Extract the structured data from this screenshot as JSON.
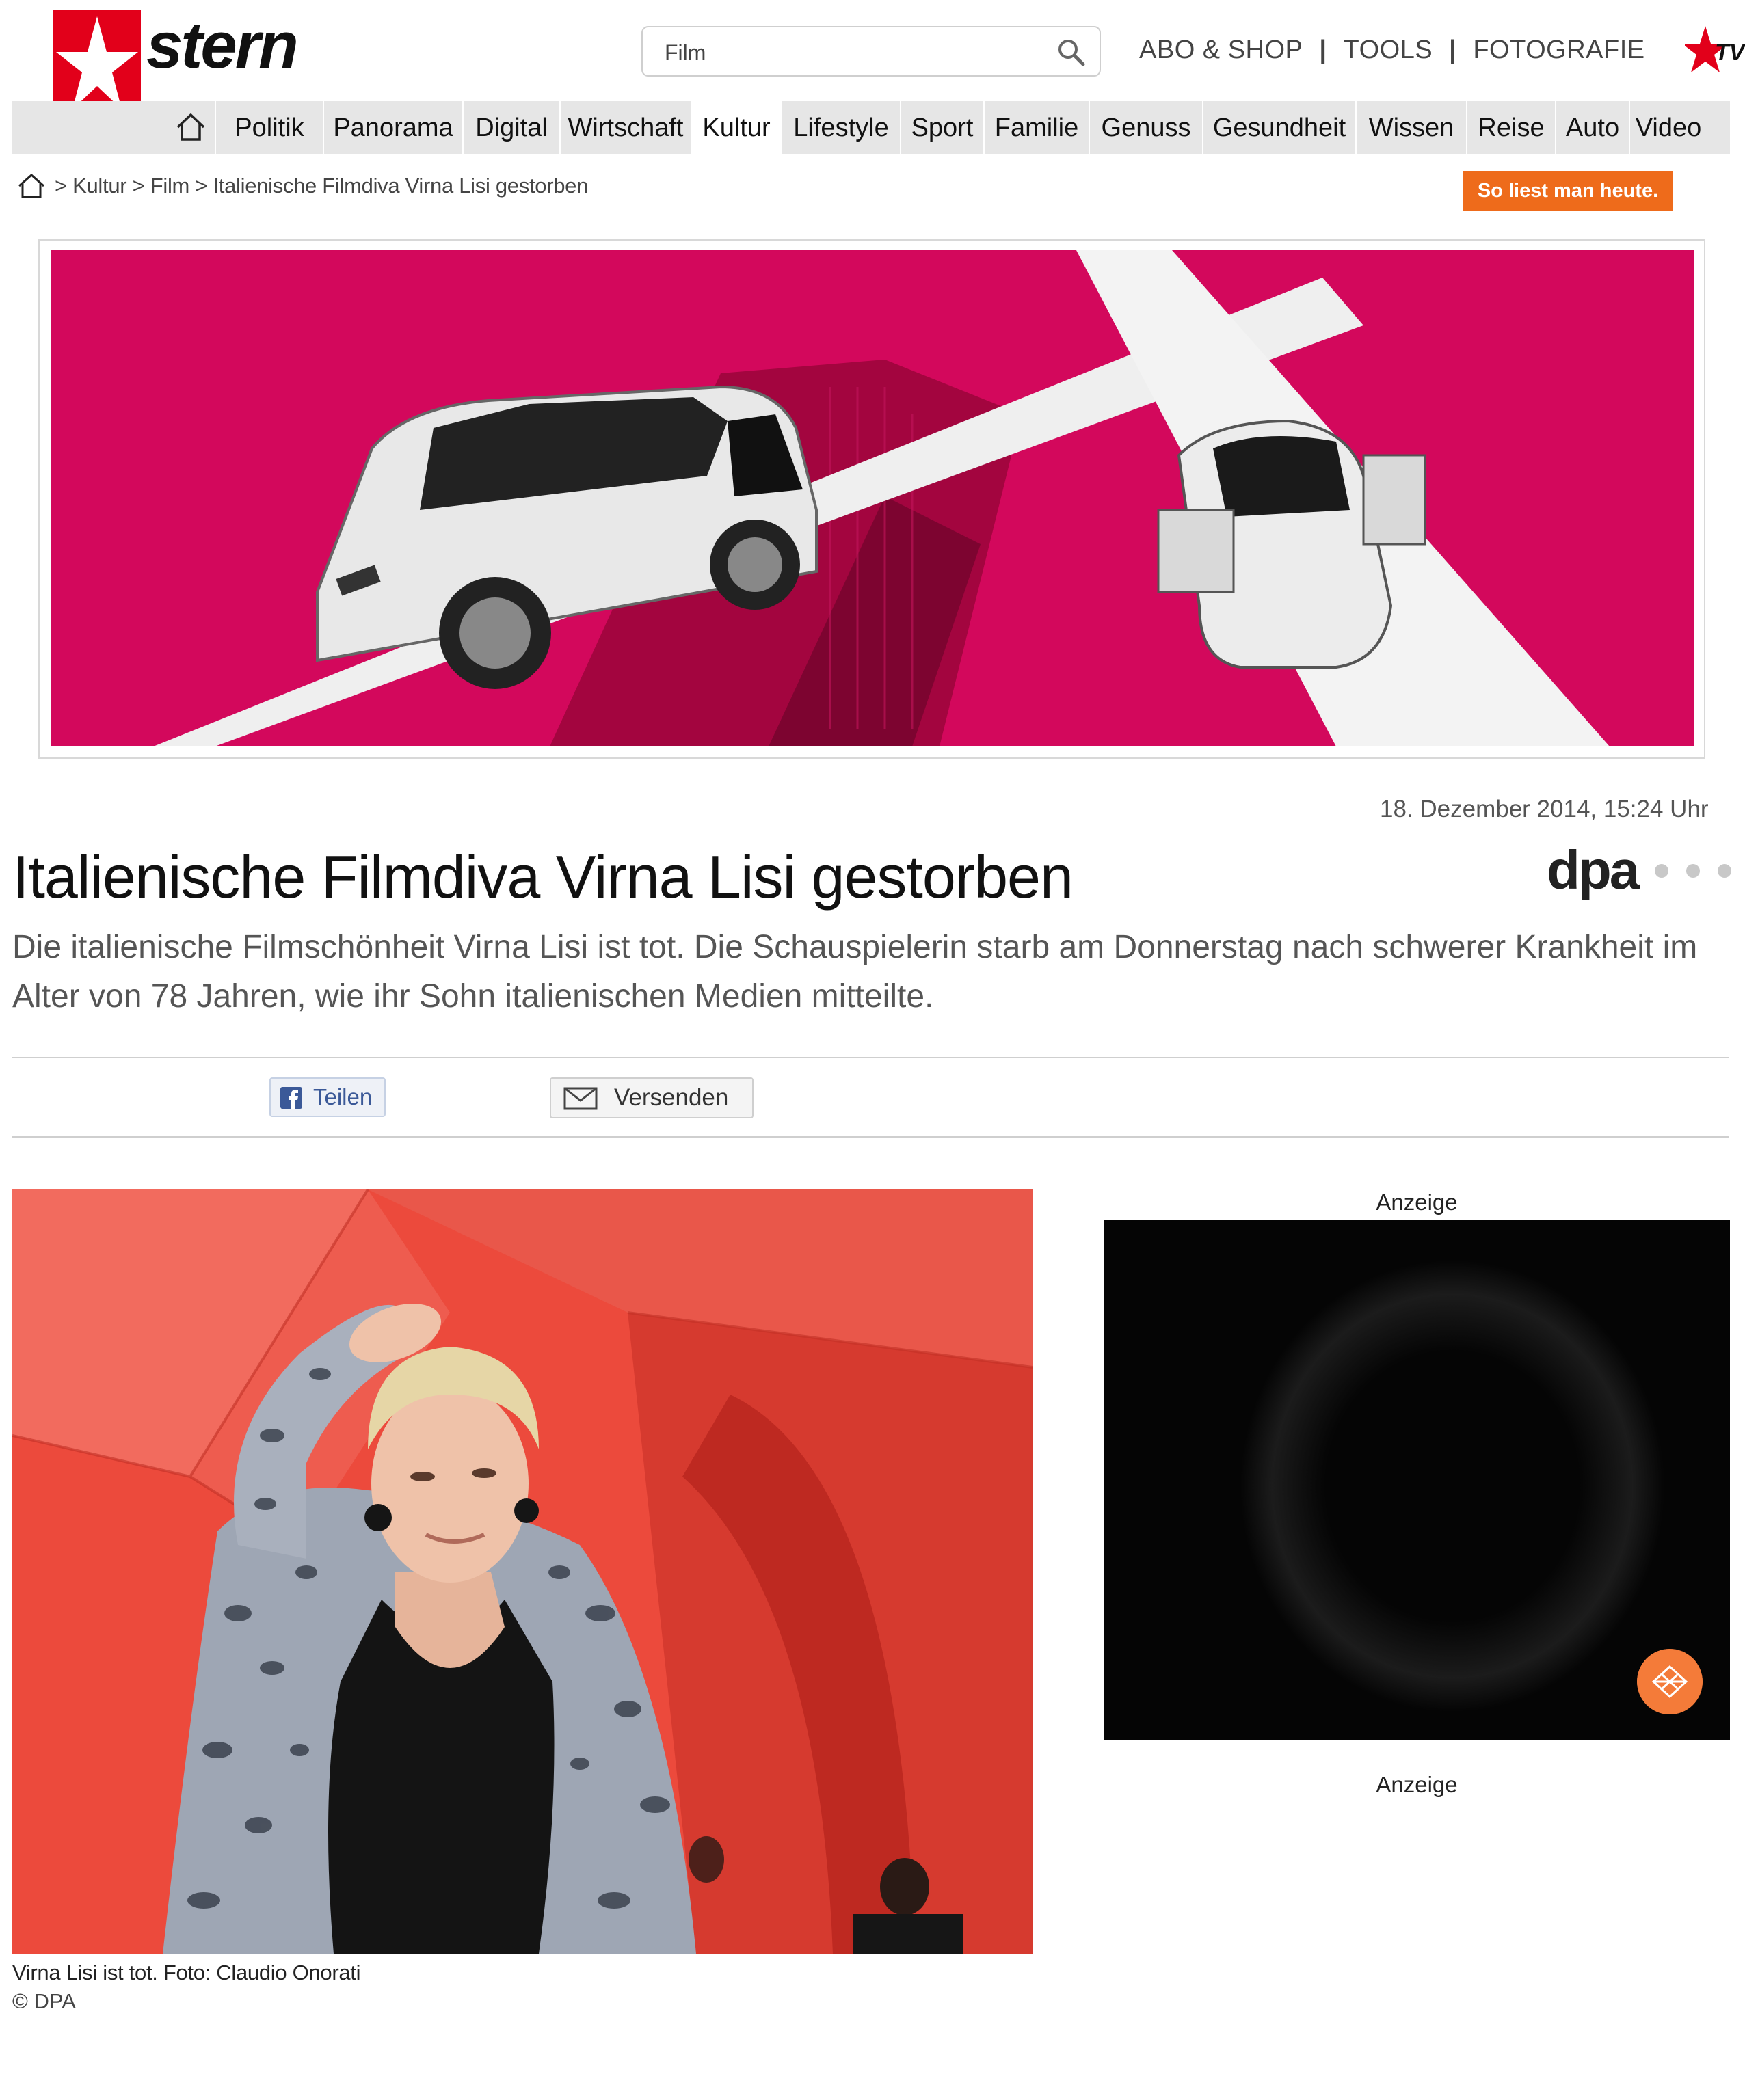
{
  "header": {
    "logo_text": "stern",
    "search": {
      "value": "Film",
      "placeholder": "Film"
    },
    "top_links": [
      "ABO & SHOP",
      "TOOLS",
      "FOTOGRAFIE"
    ],
    "separator": "|",
    "tv_logo_text": "stern TV"
  },
  "nav": {
    "items": [
      "Politik",
      "Panorama",
      "Digital",
      "Wirtschaft",
      "Kultur",
      "Lifestyle",
      "Sport",
      "Familie",
      "Genuss",
      "Gesundheit",
      "Wissen",
      "Reise",
      "Auto",
      "Video"
    ],
    "active": "Kultur"
  },
  "breadcrumb": {
    "text": "> Kultur > Film > Italienische Filmdiva Virna Lisi gestorben",
    "items": [
      "Kultur",
      "Film",
      "Italienische Filmdiva Virna Lisi gestorben"
    ]
  },
  "promo_button": "So liest man heute.",
  "article": {
    "date": "18. Dezember 2014, 15:24 Uhr",
    "agency": "dpa",
    "headline": "Italienische Filmdiva Virna Lisi gestorben",
    "intro": "Die italienische Filmschönheit Virna Lisi ist tot. Die Schauspielerin starb am Donnerstag nach schwerer Krankheit im Alter von 78 Jahren, wie ihr Sohn italienischen Medien mitteilte.",
    "share": {
      "facebook_label": "Teilen",
      "mail_label": "Versenden"
    },
    "photo_caption": "Virna Lisi ist tot. Foto: Claudio Onorati",
    "photo_credit": "© DPA"
  },
  "ads": {
    "label_top": "Anzeige",
    "label_bottom": "Anzeige"
  },
  "colors": {
    "brand_red": "#e2001a",
    "banner_magenta": "#d3085c",
    "promo_orange": "#ee6b1b",
    "nav_bg": "#e6e6e6",
    "photo_red": "#ec4a3c"
  }
}
